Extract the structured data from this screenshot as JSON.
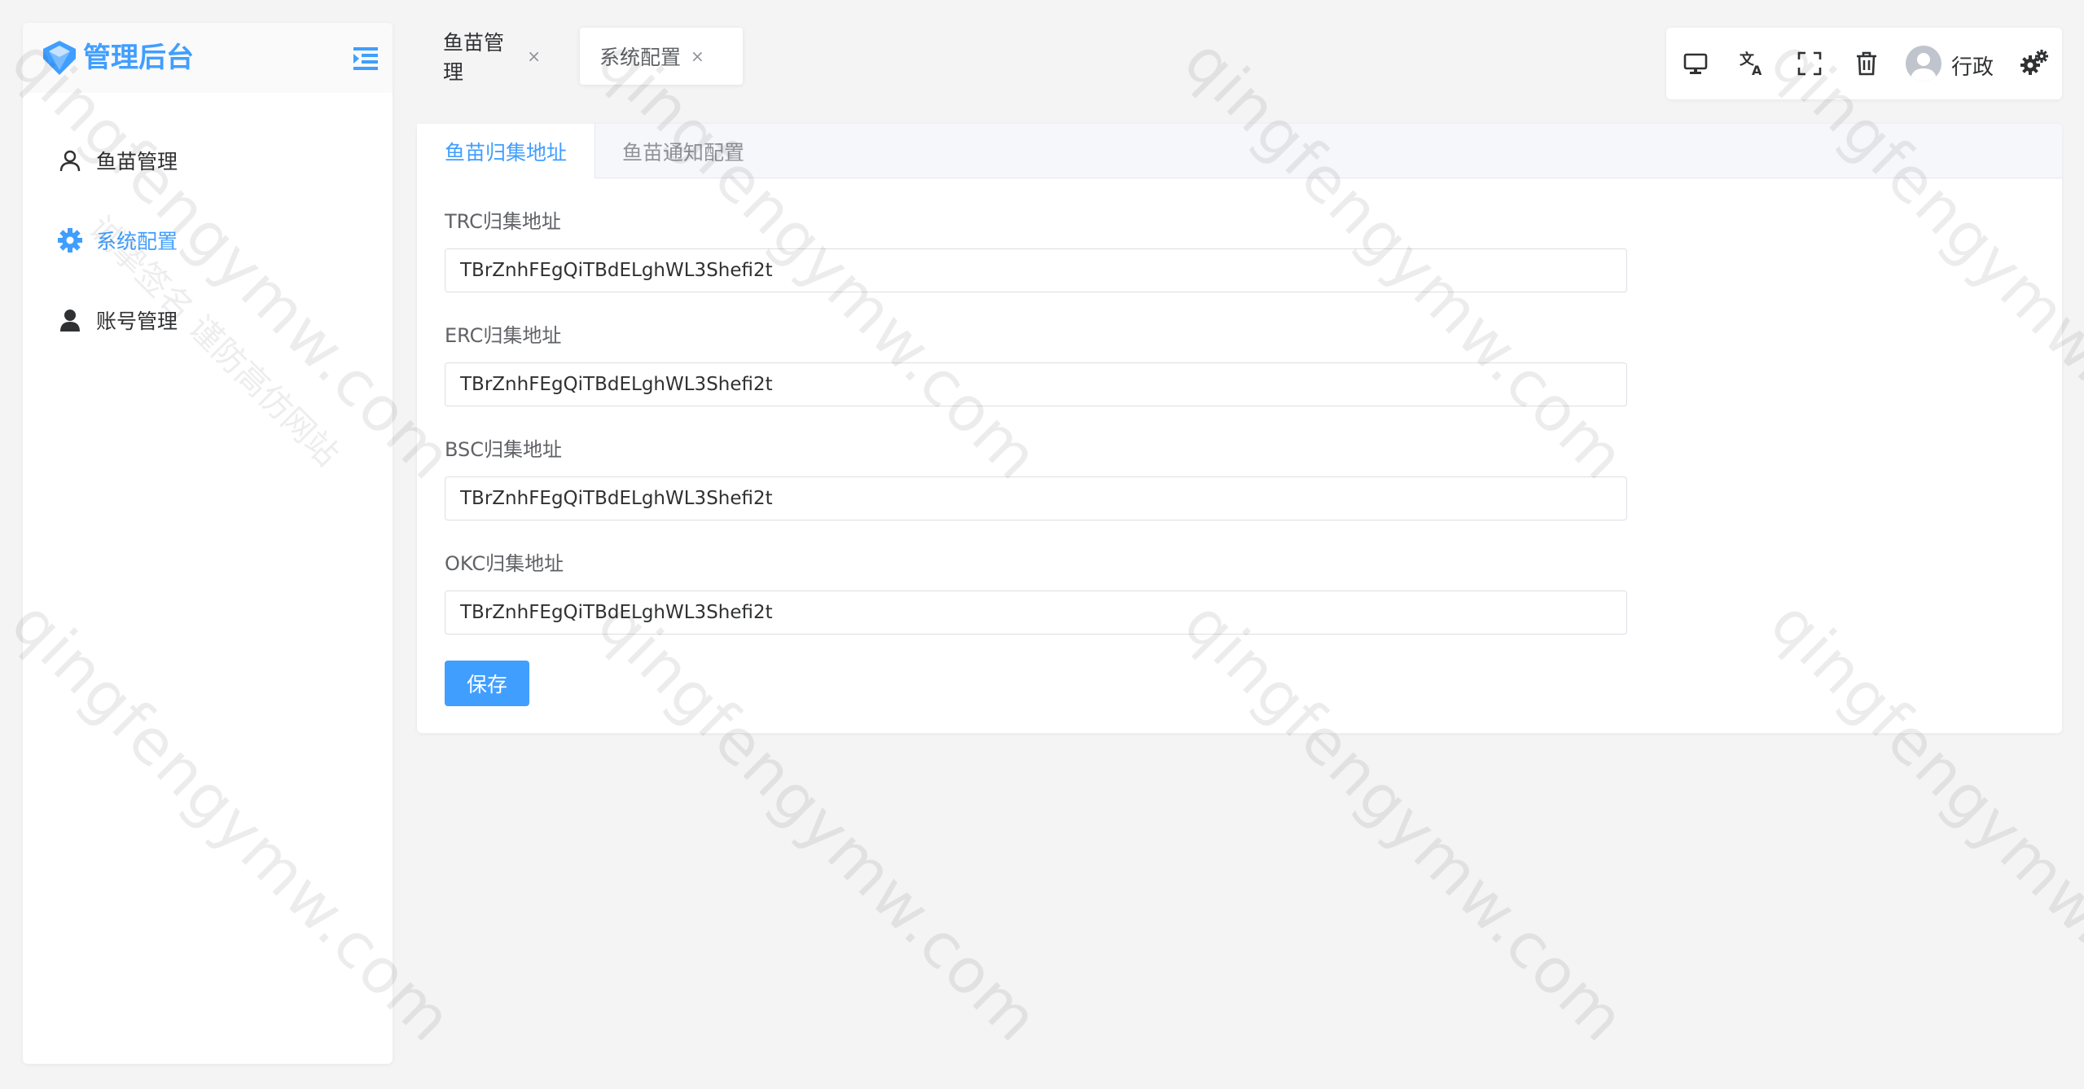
{
  "brand": {
    "title": "管理后台"
  },
  "sidebar": {
    "items": [
      {
        "label": "鱼苗管理",
        "icon": "user-outline-icon",
        "active": false
      },
      {
        "label": "系统配置",
        "icon": "gear-icon",
        "active": true
      },
      {
        "label": "账号管理",
        "icon": "user-filled-icon",
        "active": false
      }
    ]
  },
  "tabs": [
    {
      "label": "鱼苗管理",
      "close": "×"
    },
    {
      "label": "系统配置",
      "close": "×"
    }
  ],
  "toolbar": {
    "icons": [
      "monitor-icon",
      "translate-icon",
      "fullscreen-icon",
      "trash-icon",
      "settings-gears-icon"
    ],
    "user": "行政"
  },
  "main": {
    "tabs": [
      {
        "label": "鱼苗归集地址",
        "active": true
      },
      {
        "label": "鱼苗通知配置",
        "active": false
      }
    ],
    "fields": [
      {
        "label": "TRC归集地址",
        "value": "TBrZnhFEgQiTBdELghWL3Shefi2t"
      },
      {
        "label": "ERC归集地址",
        "value": "TBrZnhFEgQiTBdELghWL3Shefi2t"
      },
      {
        "label": "BSC归集地址",
        "value": "TBrZnhFEgQiTBdELghWL3Shefi2t"
      },
      {
        "label": "OKC归集地址",
        "value": "TBrZnhFEgQiTBdELghWL3Shefi2t"
      }
    ],
    "save_label": "保存"
  },
  "watermark": {
    "text": "qingfengymw.com",
    "secondary": "诚挚签名 谨防高仿网站"
  },
  "colors": {
    "accent": "#409eff",
    "background": "#f4f4f4"
  }
}
